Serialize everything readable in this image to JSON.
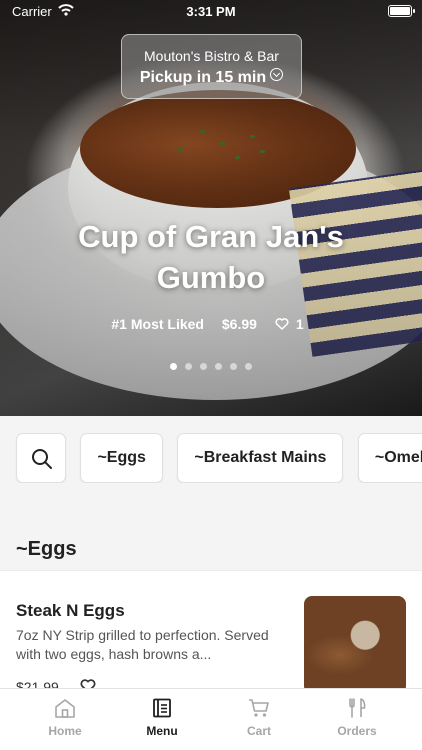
{
  "status_bar": {
    "carrier": "Carrier",
    "time": "3:31 PM"
  },
  "restaurant": {
    "name": "Mouton's Bistro & Bar",
    "pickup": "Pickup in 15 min"
  },
  "featured": {
    "title": "Cup of Gran Jan's Gumbo",
    "rank": "#1 Most Liked",
    "price": "$6.99",
    "likes": "1",
    "page_count": 6,
    "active_page": 0
  },
  "categories": [
    "~Eggs",
    "~Breakfast Mains",
    "~Omele"
  ],
  "section": {
    "title": "~Eggs"
  },
  "items": [
    {
      "name": "Steak N Eggs",
      "description": "7oz NY Strip grilled to perfection. Served with two eggs, hash browns a...",
      "price": "$21.99"
    }
  ],
  "tabs": [
    {
      "label": "Home",
      "icon": "home-icon",
      "active": false
    },
    {
      "label": "Menu",
      "icon": "menu-icon",
      "active": true
    },
    {
      "label": "Cart",
      "icon": "cart-icon",
      "active": false
    },
    {
      "label": "Orders",
      "icon": "orders-icon",
      "active": false
    }
  ],
  "colors": {
    "accent": "#1e1e1e",
    "inactive_tab": "#a6a6a6",
    "background": "#f4f4f4"
  }
}
